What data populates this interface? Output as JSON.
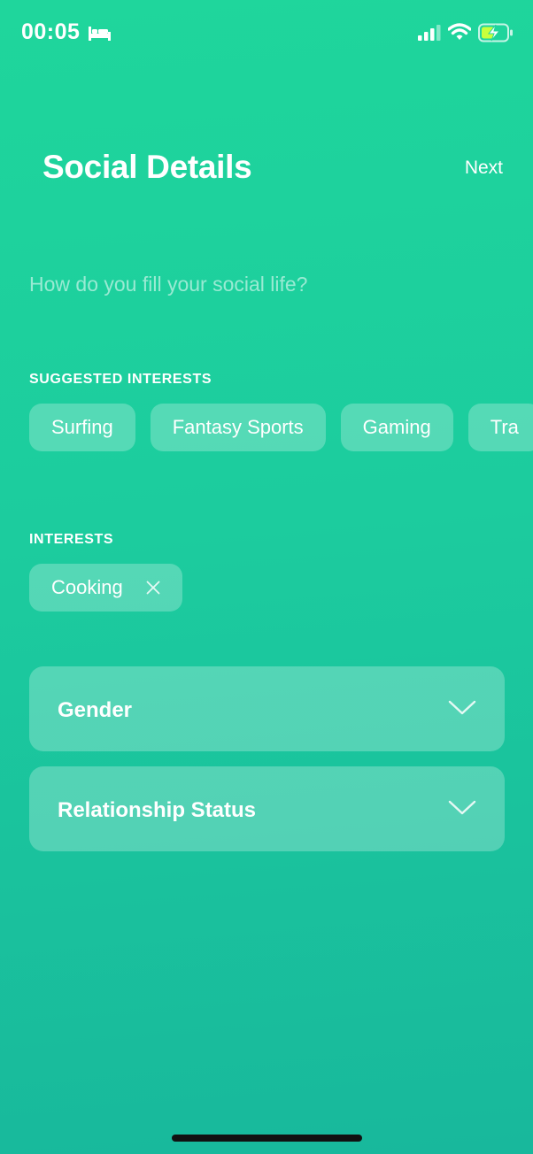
{
  "status_bar": {
    "time": "00:05"
  },
  "header": {
    "title": "Social Details",
    "next_label": "Next"
  },
  "question": "How do you fill your social life?",
  "suggested": {
    "label": "SUGGESTED INTERESTS",
    "items": [
      "Surfing",
      "Fantasy Sports",
      "Gaming",
      "Tra"
    ]
  },
  "interests": {
    "label": "INTERESTS",
    "items": [
      "Cooking"
    ]
  },
  "dropdowns": {
    "gender": "Gender",
    "relationship": "Relationship Status"
  },
  "icons": {
    "status": [
      "bed-icon",
      "signal-icon",
      "wifi-icon",
      "battery-charging-icon"
    ],
    "chip_remove": "close-icon",
    "dropdown": "chevron-down-icon"
  },
  "colors": {
    "background_top": "#1fd69c",
    "background_bottom": "#18b89c",
    "chip_fill": "rgba(255,255,255,0.25)",
    "battery_bolt": "#c8ff3c"
  }
}
